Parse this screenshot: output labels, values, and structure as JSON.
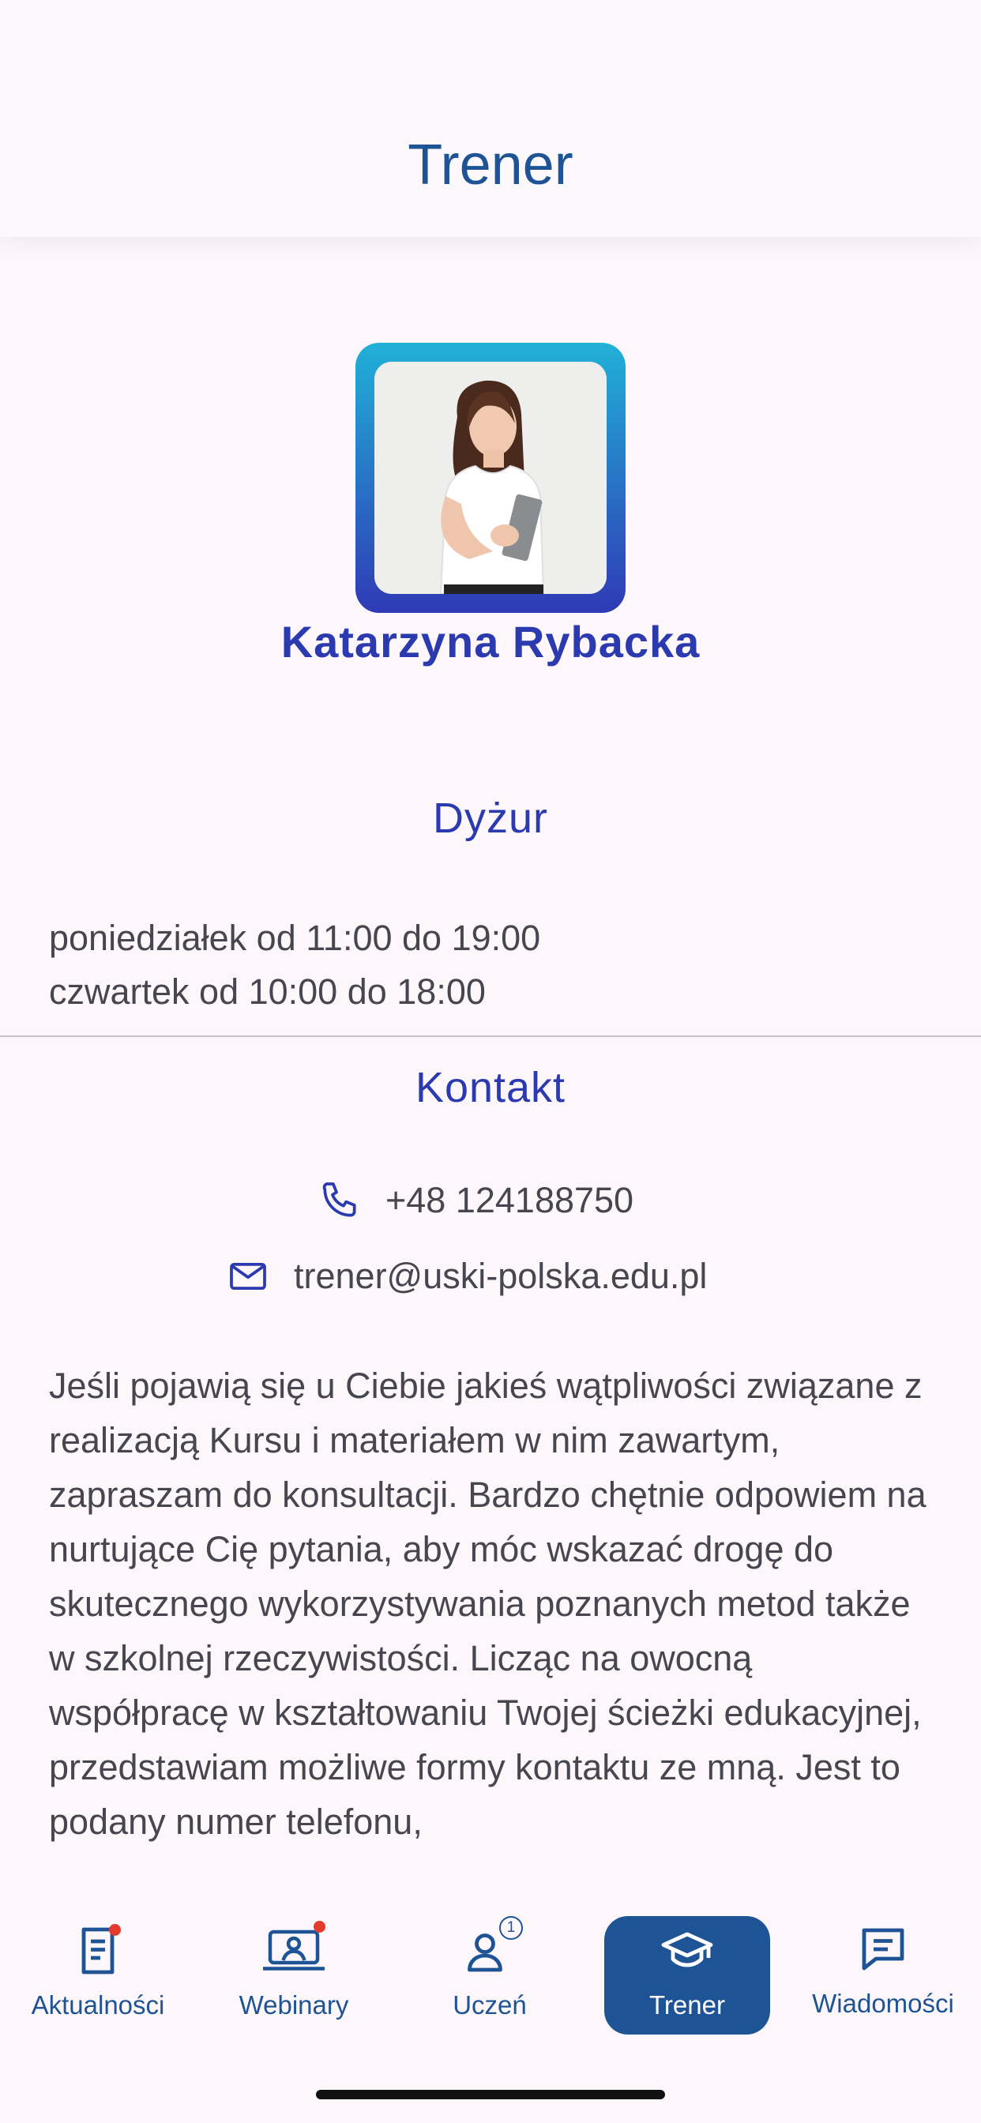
{
  "header": {
    "title": "Trener"
  },
  "trainer": {
    "name": "Katarzyna Rybacka"
  },
  "duty": {
    "title": "Dyżur",
    "lines": [
      "poniedziałek od 11:00 do 19:00",
      "czwartek od 10:00 do 18:00"
    ]
  },
  "contact": {
    "title": "Kontakt",
    "phone": "+48 124188750",
    "email": "trener@uski-polska.edu.pl",
    "phone_icon": "phone-icon",
    "email_icon": "mail-icon"
  },
  "description": "Jeśli pojawią się u Ciebie jakieś wątpliwości związane z realizacją Kursu i materiałem w nim zawartym, zapraszam do konsultacji. Bardzo chętnie odpowiem na nurtujące Cię pytania, aby móc wskazać drogę do skutecznego wykorzystywania poznanych metod także w szkolnej rzeczywistości. Licząc na owocną współpracę w kształtowaniu Twojej ścieżki edukacyjnej, przedstawiam możliwe formy kontaktu ze mną. Jest to podany numer telefonu,",
  "nav": {
    "items": [
      {
        "label": "Aktualności",
        "icon": "news-icon",
        "has_dot": true
      },
      {
        "label": "Webinary",
        "icon": "webinar-icon",
        "has_dot": true
      },
      {
        "label": "Uczeń",
        "icon": "student-icon",
        "badge": "1"
      },
      {
        "label": "Trener",
        "icon": "graduation-cap-icon",
        "active": true
      },
      {
        "label": "Wiadomości",
        "icon": "message-icon"
      }
    ]
  },
  "colors": {
    "primary": "#1e5495",
    "accent": "#2c3ab0",
    "background": "#fdf7fb",
    "notification": "#e53b2e"
  }
}
